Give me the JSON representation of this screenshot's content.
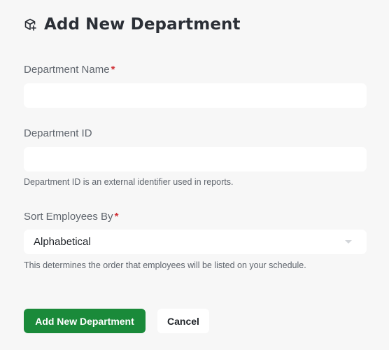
{
  "header": {
    "title": "Add New Department",
    "icon": "add-box-icon"
  },
  "form": {
    "name_field": {
      "label": "Department Name",
      "required_marker": "*",
      "value": "",
      "placeholder": ""
    },
    "id_field": {
      "label": "Department ID",
      "value": "",
      "placeholder": "",
      "help": "Department ID is an external identifier used in reports."
    },
    "sort_field": {
      "label": "Sort Employees By",
      "required_marker": "*",
      "selected": "Alphabetical",
      "help": "This determines the order that employees will be listed on your schedule."
    }
  },
  "actions": {
    "submit_label": "Add New Department",
    "cancel_label": "Cancel"
  },
  "colors": {
    "primary": "#1a8a3a",
    "required": "#d1343a",
    "background": "#f7f7f7"
  }
}
